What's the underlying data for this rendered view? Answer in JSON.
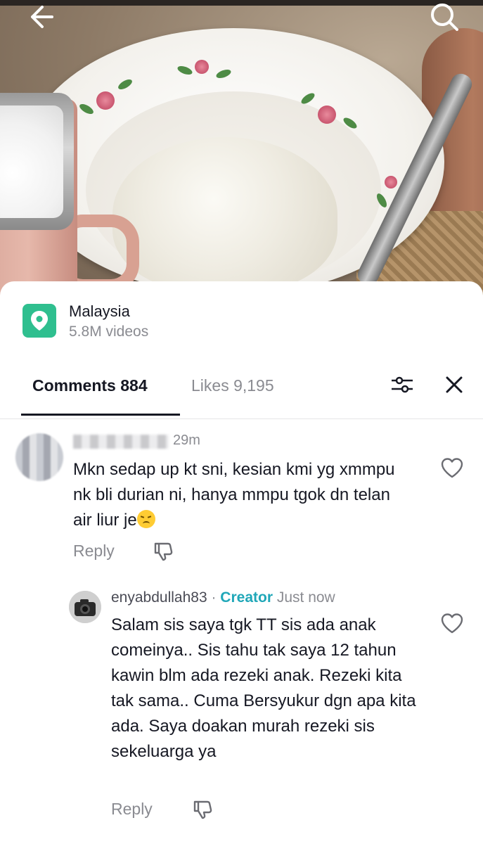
{
  "video": {
    "back_icon": "arrow-left-icon",
    "search_icon": "search-icon"
  },
  "location": {
    "icon": "location-pin-icon",
    "accent_color": "#2fbf8f",
    "name": "Malaysia",
    "video_count": "5.8M videos"
  },
  "tabs": {
    "comments_label": "Comments 884",
    "likes_label": "Likes 9,195",
    "filter_icon": "sliders-icon",
    "close_icon": "close-icon"
  },
  "comments": [
    {
      "username": "",
      "time": "29m",
      "text": "Mkn sedap up kt sni, kesian kmi yg xmmpu nk bli durian ni, hanya mmpu tgok dn telan air liur je",
      "emoji": "disappointed-face",
      "reply_label": "Reply"
    },
    {
      "username": "enyabdullah83",
      "separator": " · ",
      "badge": "Creator",
      "badge_color": "#20a7b8",
      "time": "Just now",
      "text": "Salam sis saya tgk TT sis ada anak comeinya.. Sis tahu tak saya 12 tahun kawin blm ada rezeki anak. Rezeki kita tak sama.. Cuma Bersyukur dgn apa kita ada. Saya doakan murah rezeki sis sekeluarga ya",
      "reply_label": "Reply"
    }
  ]
}
